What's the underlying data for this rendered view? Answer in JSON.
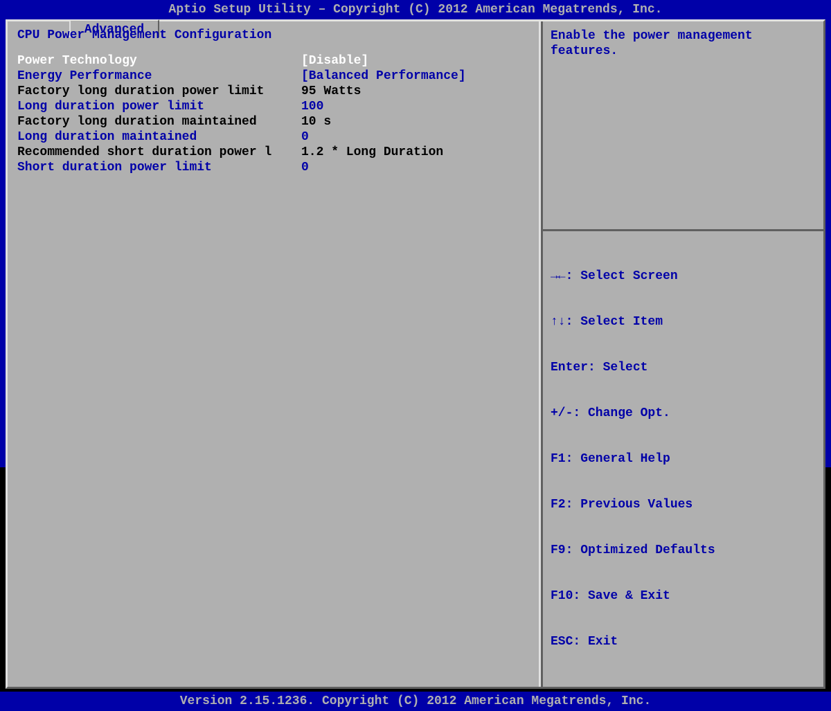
{
  "header": "Aptio Setup Utility – Copyright (C) 2012 American Megatrends, Inc.",
  "tab": "Advanced",
  "section_title": "CPU Power Management Configuration",
  "options": [
    {
      "label": "Power Technology",
      "value": "[Disable]",
      "type": "selected"
    },
    {
      "label": "Energy Performance",
      "value": "[Balanced Performance]",
      "type": "editable"
    },
    {
      "label": "Factory long duration power limit",
      "value": "95 Watts",
      "type": "info"
    },
    {
      "label": "Long duration power limit",
      "value": "100",
      "type": "editable"
    },
    {
      "label": "Factory long duration maintained",
      "value": "10 s",
      "type": "info"
    },
    {
      "label": "Long duration maintained",
      "value": "0",
      "type": "editable"
    },
    {
      "label": "Recommended short duration power l",
      "value": "1.2 * Long Duration",
      "type": "info"
    },
    {
      "label": "Short duration power limit",
      "value": "0",
      "type": "editable"
    }
  ],
  "help_text": "Enable the power management features.",
  "key_help": [
    "→←: Select Screen",
    "↑↓: Select Item",
    "Enter: Select",
    "+/-: Change Opt.",
    "F1: General Help",
    "F2: Previous Values",
    "F9: Optimized Defaults",
    "F10: Save & Exit",
    "ESC: Exit"
  ],
  "footer": "Version 2.15.1236. Copyright (C) 2012 American Megatrends, Inc."
}
